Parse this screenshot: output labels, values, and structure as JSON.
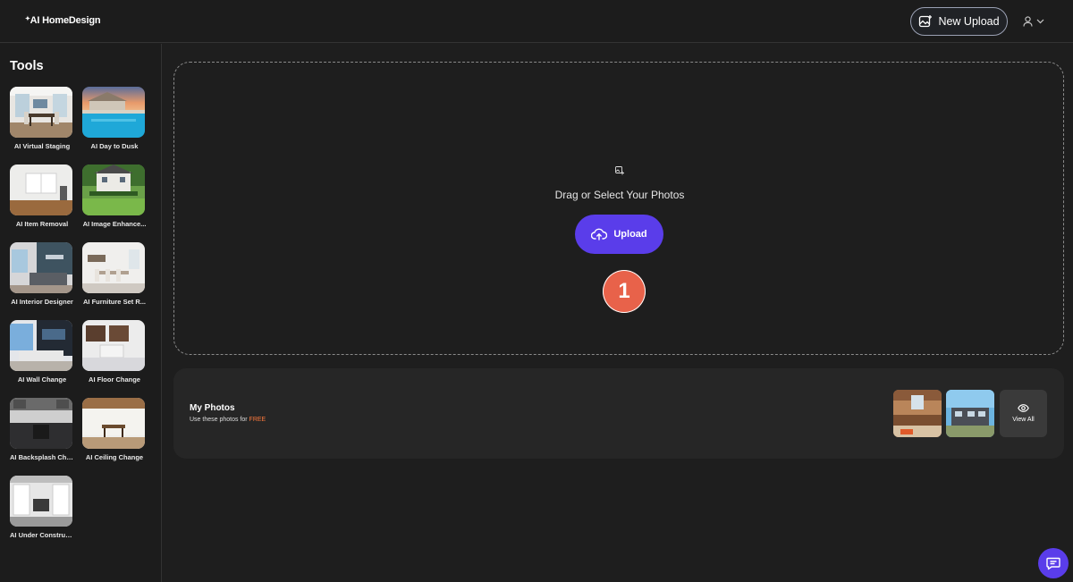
{
  "header": {
    "logo_text": "AI HomeDesign",
    "new_upload_label": "New Upload"
  },
  "sidebar": {
    "title": "Tools",
    "tools": [
      {
        "label": "AI Virtual Staging",
        "icon": "virtual-staging-thumbnail"
      },
      {
        "label": "AI Day to Dusk",
        "icon": "day-to-dusk-thumbnail"
      },
      {
        "label": "AI Item Removal",
        "icon": "item-removal-thumbnail"
      },
      {
        "label": "AI Image Enhance...",
        "icon": "image-enhance-thumbnail"
      },
      {
        "label": "AI Interior Designer",
        "icon": "interior-designer-thumbnail"
      },
      {
        "label": "AI Furniture Set R...",
        "icon": "furniture-set-thumbnail"
      },
      {
        "label": "AI Wall Change",
        "icon": "wall-change-thumbnail"
      },
      {
        "label": "AI Floor Change",
        "icon": "floor-change-thumbnail"
      },
      {
        "label": "AI Backsplash Cha...",
        "icon": "backsplash-change-thumbnail"
      },
      {
        "label": "AI Ceiling Change",
        "icon": "ceiling-change-thumbnail"
      },
      {
        "label": "AI Under Construc...",
        "icon": "under-construction-thumbnail"
      }
    ]
  },
  "dropzone": {
    "prompt": "Drag or Select Your Photos",
    "upload_label": "Upload",
    "step_number": "1"
  },
  "my_photos": {
    "title": "My Photos",
    "subtitle_prefix": "Use these photos for ",
    "subtitle_highlight": "FREE",
    "view_all_label": "View All"
  },
  "colors": {
    "accent": "#5a3dea",
    "step_badge": "#e8624a",
    "free_highlight": "#ff7a3d",
    "background": "#1e1e1e"
  }
}
